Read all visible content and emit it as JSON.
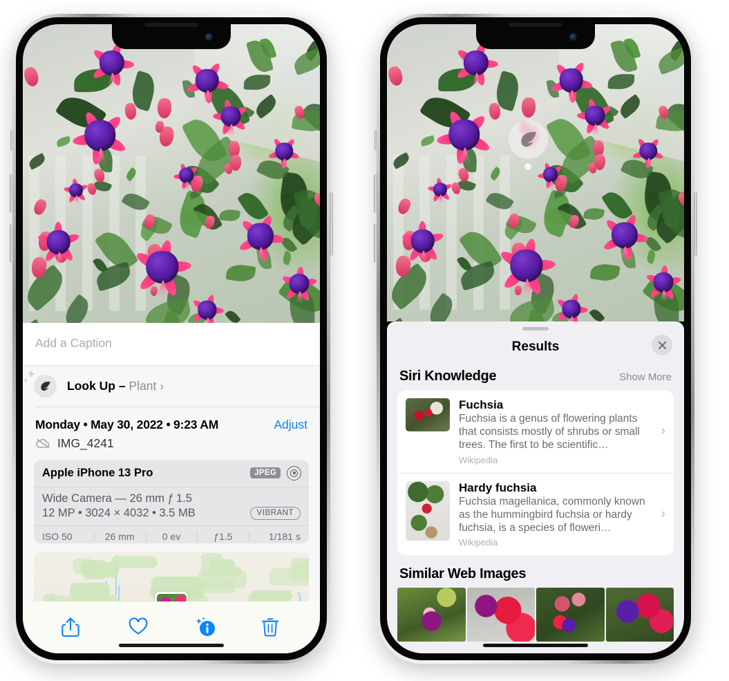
{
  "left_phone": {
    "caption": {
      "placeholder": "Add a Caption",
      "value": ""
    },
    "lookup": {
      "label": "Look Up – ",
      "subject": "Plant",
      "icon": "leaf-icon",
      "chevron": "›"
    },
    "metadata": {
      "date": "Monday • May 30, 2022 • 9:23 AM",
      "adjust_label": "Adjust",
      "filename": "IMG_4241",
      "cloud_icon": "icloud-slash-icon"
    },
    "camera_card": {
      "model": "Apple iPhone 13 Pro",
      "format_badge": "JPEG",
      "aperture_icon": "aperture-icon",
      "lens_line": "Wide Camera — 26 mm ƒ 1.5",
      "size_line": "12 MP • 3024 × 4032 • 3.5 MB",
      "style_badge": "VIBRANT",
      "exif": [
        "ISO 50",
        "26 mm",
        "0 ev",
        "ƒ1.5",
        "1/181 s"
      ]
    },
    "toolbar": [
      {
        "name": "share-icon",
        "label": "Share"
      },
      {
        "name": "heart-icon",
        "label": "Favorite"
      },
      {
        "name": "info-icon",
        "label": "Info"
      },
      {
        "name": "trash-icon",
        "label": "Delete"
      }
    ]
  },
  "right_phone": {
    "visual_lookup_badge": {
      "icon": "leaf-icon"
    },
    "sheet": {
      "title": "Results",
      "close_icon": "close-icon",
      "siri_section": {
        "title": "Siri Knowledge",
        "show_more": "Show More",
        "items": [
          {
            "title": "Fuchsia",
            "description": "Fuchsia is a genus of flowering plants that consists mostly of shrubs or small trees. The first to be scientific…",
            "source": "Wikipedia",
            "chevron": "›"
          },
          {
            "title": "Hardy fuchsia",
            "description": "Fuchsia magellanica, commonly known as the hummingbird fuchsia or hardy fuchsia, is a species of floweri…",
            "source": "Wikipedia",
            "chevron": "›"
          }
        ]
      },
      "similar_section": {
        "title": "Similar Web Images",
        "thumbnails": [
          {
            "name": "web-image-1"
          },
          {
            "name": "web-image-2"
          },
          {
            "name": "web-image-3"
          },
          {
            "name": "web-image-4"
          }
        ]
      }
    }
  },
  "colors": {
    "accent_blue": "#0a84ff",
    "sheet_bg": "#f0f0f4",
    "panel_bg": "#f7f7f7",
    "card_bg": "#e6e6e9",
    "secondary_text": "#8a8a8e"
  }
}
